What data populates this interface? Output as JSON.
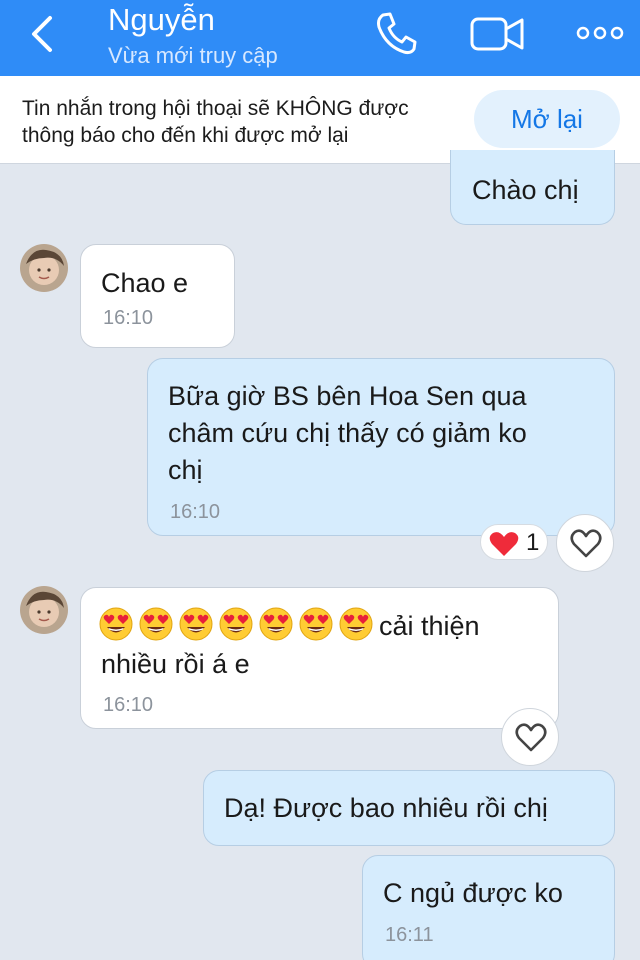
{
  "header": {
    "title": "Nguyễn",
    "status": "Vừa mới truy cập"
  },
  "banner": {
    "line1": "Tin nhắn trong hội thoại sẽ KHÔNG được",
    "line2": "thông báo cho đến khi được mở lại",
    "reopen_label": "Mở lại"
  },
  "messages": [
    {
      "direction": "out",
      "text": "Chào chị"
    },
    {
      "direction": "in",
      "text": "Chao e",
      "time": "16:10"
    },
    {
      "direction": "out",
      "lines": [
        "Bữa giờ BS bên Hoa Sen qua",
        "châm cứu chị thấy có giảm ko",
        "chị"
      ],
      "time": "16:10",
      "reaction_count": "1"
    },
    {
      "direction": "in",
      "emoji_count": 7,
      "text_after_emoji": "cải thiện",
      "line2": "nhiều rồi á e",
      "time": "16:10"
    },
    {
      "direction": "out",
      "text": "Dạ! Được bao nhiêu rồi chị"
    },
    {
      "direction": "out",
      "text": "C ngủ được ko",
      "time": "16:11"
    }
  ],
  "colors": {
    "header_bg": "#2f8cf7",
    "background": "#e1e7ef",
    "outgoing_bubble": "#d6ecfd",
    "incoming_bubble": "#ffffff",
    "reopen_text": "#1477e6"
  },
  "icons": [
    "back-icon",
    "phone-icon",
    "video-call-icon",
    "more-icon",
    "heart-icon",
    "heart-eyes-emoji"
  ]
}
